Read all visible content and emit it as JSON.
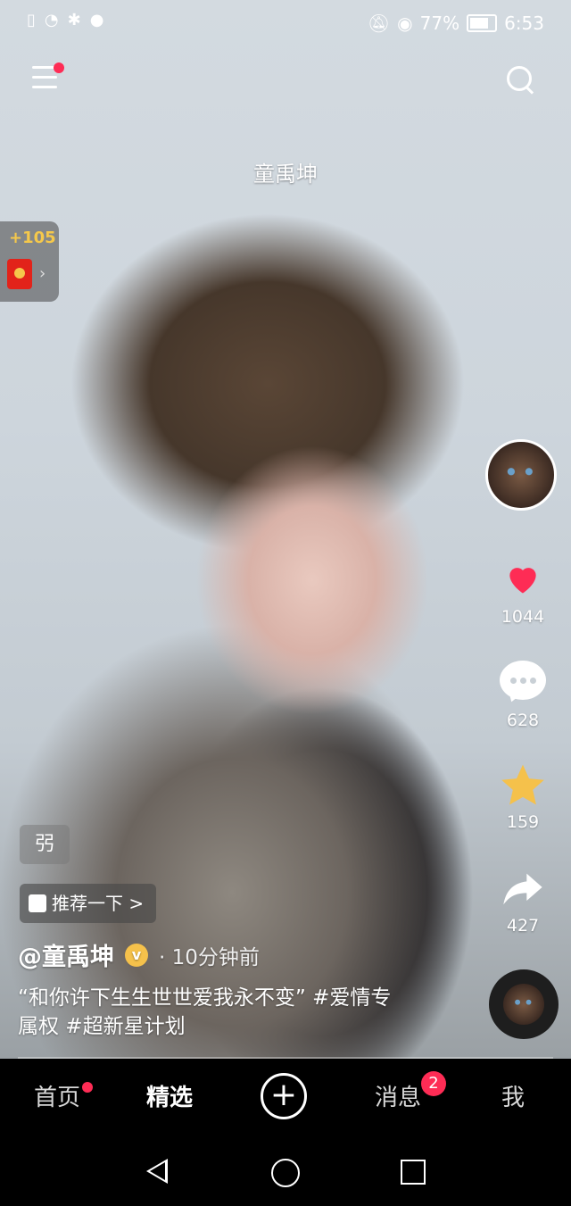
{
  "status_bar": {
    "battery": "77%",
    "time": "6:53",
    "left_icons": [
      "sim-icon",
      "wifi-icon",
      "bluetooth-icon",
      "app-notification-icon"
    ],
    "right_icons": [
      "mute-icon",
      "eye-icon",
      "battery-icon"
    ]
  },
  "header": {
    "video_title": "童禹坤"
  },
  "coin_widget": {
    "amount": "+105",
    "arrow": "›"
  },
  "rail": {
    "likes": "1044",
    "comments": "628",
    "favorites": "159",
    "shares": "427"
  },
  "video": {
    "mix_tag": "弜",
    "recommend_label": "推荐一下 >",
    "author": "@童禹坤",
    "verified_symbol": "v",
    "time_ago": "· 10分钟前",
    "caption": "“和你许下生生世世爱我永不变” #爱情专属权 #超新星计划",
    "progress": 0.0
  },
  "tabs": {
    "home": "首页",
    "featured": "精选",
    "create": "+",
    "messages": "消息",
    "messages_badge": "2",
    "me": "我"
  },
  "colors": {
    "accent": "#fe2c55",
    "verified": "#f5c14b",
    "coin": "#f5c84b"
  }
}
